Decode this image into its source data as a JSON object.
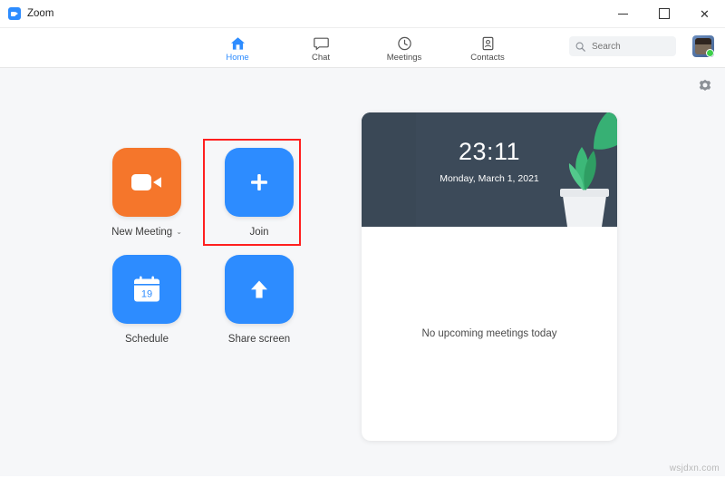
{
  "window": {
    "title": "Zoom",
    "app_icon": "zoom-camera-icon",
    "minimize_label": "–",
    "maximize_label": "□",
    "close_label": "✕"
  },
  "nav": {
    "items": [
      {
        "label": "Home",
        "icon": "home-icon",
        "active": true
      },
      {
        "label": "Chat",
        "icon": "chat-bubble-icon",
        "active": false
      },
      {
        "label": "Meetings",
        "icon": "clock-icon",
        "active": false
      },
      {
        "label": "Contacts",
        "icon": "contacts-icon",
        "active": false
      }
    ],
    "search": {
      "placeholder": "Search",
      "value": "",
      "icon": "search-icon"
    },
    "avatar": {
      "name": "user-avatar",
      "status": "available"
    },
    "settings_icon": "gear-icon",
    "accent_color": "#2d8cff"
  },
  "actions": [
    {
      "label": "New Meeting",
      "icon": "video-camera-icon",
      "color": "#f5762b",
      "has_dropdown": true,
      "dropdown_glyph": "⌄",
      "highlighted": false
    },
    {
      "label": "Join",
      "icon": "plus-icon",
      "color": "#2d8cff",
      "has_dropdown": false,
      "dropdown_glyph": "",
      "highlighted": true
    },
    {
      "label": "Schedule",
      "icon": "calendar-icon",
      "calendar_day": "19",
      "color": "#2d8cff",
      "has_dropdown": false,
      "dropdown_glyph": "",
      "highlighted": false
    },
    {
      "label": "Share screen",
      "icon": "up-arrow-icon",
      "color": "#2d8cff",
      "has_dropdown": false,
      "dropdown_glyph": "",
      "highlighted": false
    }
  ],
  "highlight": {
    "color": "#ff1f1f",
    "target": "Join"
  },
  "meetings_card": {
    "time": "23:11",
    "date": "Monday, March 1, 2021",
    "empty_text": "No upcoming meetings today",
    "banner_image": "plant-on-desk-illustration"
  },
  "watermark": "wsjdxn.com"
}
